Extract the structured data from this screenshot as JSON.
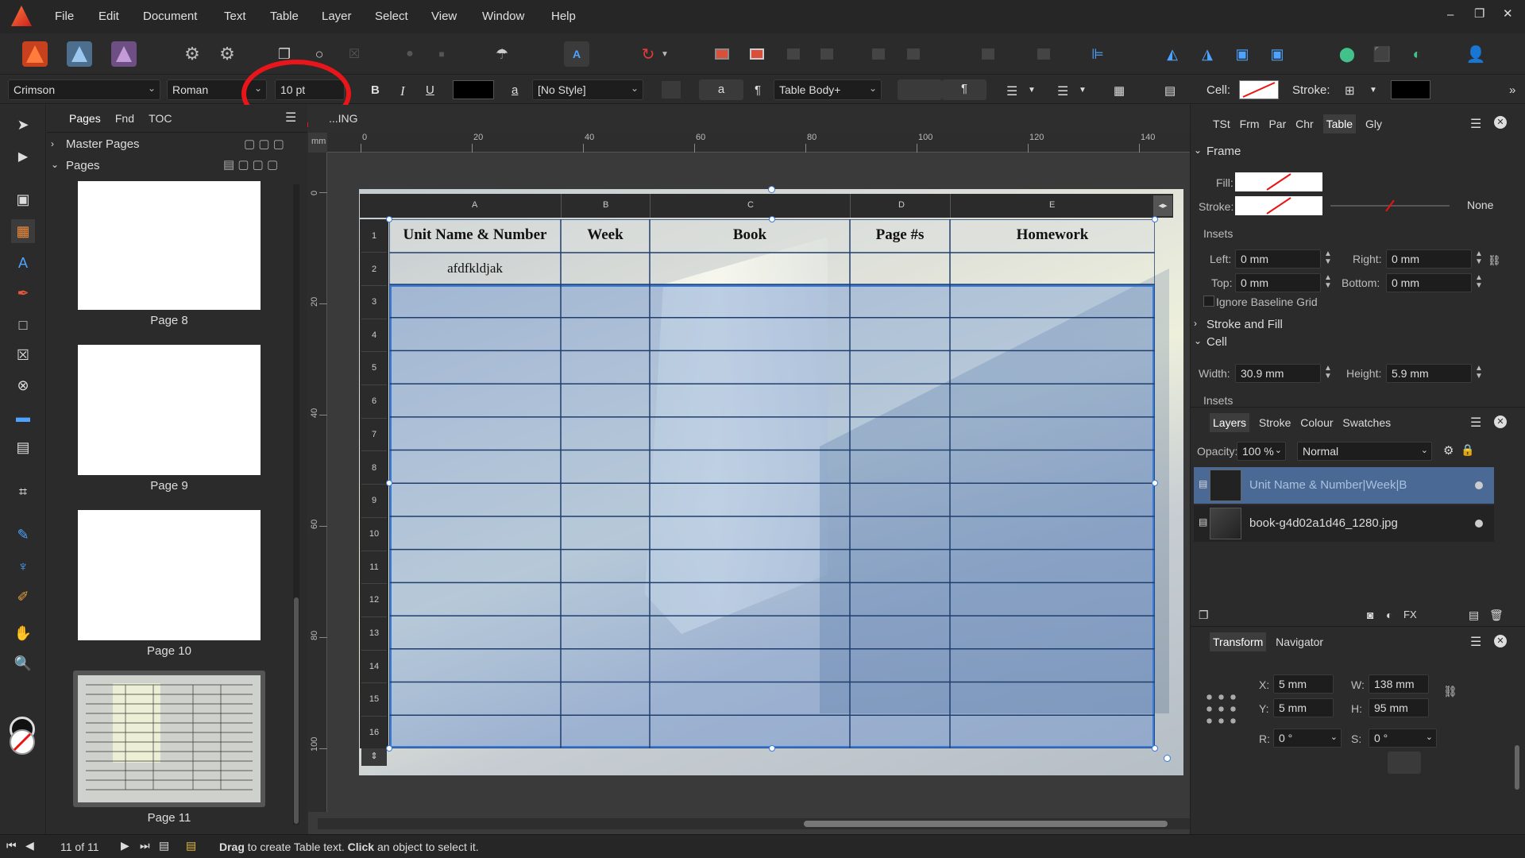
{
  "menu": [
    "File",
    "Edit",
    "Document",
    "Text",
    "Table",
    "Layer",
    "Select",
    "View",
    "Window",
    "Help"
  ],
  "context": {
    "font_family": "Crimson",
    "font_style": "Roman",
    "font_size": "10 pt",
    "bold": "B",
    "italic": "I",
    "underline": "U",
    "char_style": "[No Style]",
    "para_style": "Table Body+",
    "cell_label": "Cell:",
    "stroke_label": "Stroke:"
  },
  "pages_panel": {
    "tabs": [
      "Pages",
      "Fnd",
      "TOC"
    ],
    "master_pages": "Master Pages",
    "pages": "Pages",
    "thumbnails": [
      "Page 8",
      "Page 9",
      "Page 10",
      "Page 11"
    ]
  },
  "document_tab": "...ING",
  "ruler": {
    "unit": "mm",
    "h_ticks": [
      "0",
      "20",
      "40",
      "60",
      "80",
      "100",
      "120",
      "140"
    ],
    "v_ticks": [
      "0",
      "20",
      "40",
      "60",
      "80",
      "100"
    ]
  },
  "table": {
    "columns": [
      "A",
      "B",
      "C",
      "D",
      "E"
    ],
    "rows": [
      "1",
      "2",
      "3",
      "4",
      "5",
      "6",
      "7",
      "8",
      "9",
      "10",
      "11",
      "12",
      "13",
      "14",
      "15",
      "16"
    ],
    "header": [
      "Unit Name & Number",
      "Week",
      "Book",
      "Page #s",
      "Homework"
    ],
    "row2_col1": "afdfkldjak"
  },
  "right_tabs": [
    "TSt",
    "Frm",
    "Par",
    "Chr",
    "Table",
    "Gly"
  ],
  "frame": {
    "title": "Frame",
    "fill_label": "Fill:",
    "stroke_label": "Stroke:",
    "stroke_none": "None",
    "insets": "Insets",
    "left_label": "Left:",
    "left_value": "0 mm",
    "right_label": "Right:",
    "right_value": "0 mm",
    "top_label": "Top:",
    "top_value": "0 mm",
    "bottom_label": "Bottom:",
    "bottom_value": "0 mm",
    "ignore_baseline": "Ignore Baseline Grid",
    "stroke_and_fill": "Stroke and Fill",
    "cell": "Cell",
    "width_label": "Width:",
    "width_value": "30.9 mm",
    "height_label": "Height:",
    "height_value": "5.9 mm",
    "insets2": "Insets"
  },
  "layers_panel": {
    "tabs": [
      "Layers",
      "Stroke",
      "Colour",
      "Swatches"
    ],
    "opacity_label": "Opacity:",
    "opacity_value": "100 %",
    "blend_mode": "Normal",
    "layers": [
      "Unit Name & Number|Week|B",
      "book-g4d02a1d46_1280.jpg"
    ]
  },
  "transform_panel": {
    "tabs": [
      "Transform",
      "Navigator"
    ],
    "x_label": "X:",
    "x_value": "5 mm",
    "y_label": "Y:",
    "y_value": "5 mm",
    "w_label": "W:",
    "w_value": "138 mm",
    "h_label": "H:",
    "h_value": "95 mm",
    "r_label": "R:",
    "r_value": "0 °",
    "s_label": "S:",
    "s_value": "0 °"
  },
  "status": {
    "page_count": "11 of 11",
    "drag": "Drag",
    "drag_text": " to create Table text. ",
    "click": "Click",
    "click_text": " an object to select it."
  },
  "colors": {
    "accent": "#3a7bd5",
    "highlight_circle": "#e8151b",
    "selected_layer": "#4a6a95"
  }
}
